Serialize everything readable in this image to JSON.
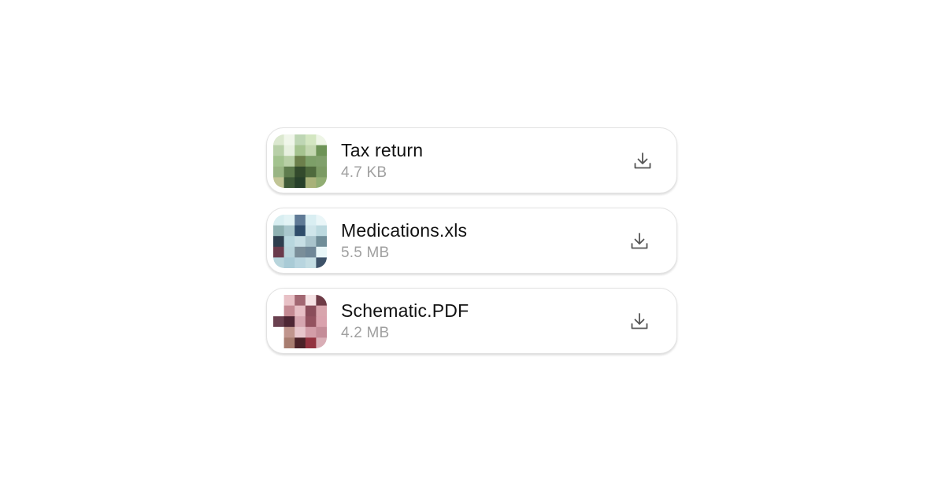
{
  "files": [
    {
      "name": "Tax return",
      "size": "4.7 KB",
      "thumbnail_palette": [
        [
          "#dbe8cf",
          "#f0f6ea",
          "#bed6b4",
          "#d3e6c1",
          "#eef5e6"
        ],
        [
          "#b8d0a8",
          "#e7f0df",
          "#a5c38f",
          "#c3d7b0",
          "#6d9356"
        ],
        [
          "#a3c38f",
          "#b8cfa6",
          "#6c7f4b",
          "#7d9f68",
          "#80a06b"
        ],
        [
          "#99b584",
          "#5f7c4e",
          "#334a2c",
          "#4f6a3d",
          "#7b9a63"
        ],
        [
          "#c1c596",
          "#3f5a38",
          "#27402a",
          "#a8b179",
          "#91ad73"
        ]
      ],
      "download_icon": "download-icon"
    },
    {
      "name": "Medications.xls",
      "size": "5.5 MB",
      "thumbnail_palette": [
        [
          "#d8eef1",
          "#e2f3f5",
          "#5f7a96",
          "#d9eef2",
          "#eaf6f8"
        ],
        [
          "#8fb1b2",
          "#a9c7cd",
          "#2f4d6b",
          "#cfe5ea",
          "#bcd9df"
        ],
        [
          "#2e3e4e",
          "#b8d7de",
          "#c7dfe5",
          "#a9c4cc",
          "#6f8d98"
        ],
        [
          "#6a3a4b",
          "#b7d3da",
          "#7a8e99",
          "#6f8797",
          "#e8f6f8"
        ],
        [
          "#b8d5dc",
          "#a9cbd6",
          "#b8d5df",
          "#c4dde3",
          "#3d5268"
        ]
      ],
      "download_icon": "download-icon"
    },
    {
      "name": "Schematic.PDF",
      "size": "4.2 MB",
      "thumbnail_palette": [
        [
          "#ffffff",
          "#e8c1c6",
          "#a26772",
          "#f5e2e4",
          "#6e3b46"
        ],
        [
          "#ffffff",
          "#c48a93",
          "#e7bfc5",
          "#8a4d5a",
          "#d8a5ad"
        ],
        [
          "#6a4150",
          "#4e2634",
          "#d6a6b0",
          "#93525f",
          "#d9a2ad"
        ],
        [
          "#ffffff",
          "#c0958d",
          "#e7c5cb",
          "#d39da8",
          "#c48c98"
        ],
        [
          "#ffffff",
          "#a87d70",
          "#4b2228",
          "#93323f",
          "#d9aeb6"
        ]
      ],
      "download_icon": "download-icon"
    }
  ],
  "colors": {
    "name_text": "#111111",
    "size_text": "#a0a0a0",
    "icon_stroke": "#555555",
    "card_border": "#e2e2e2"
  }
}
